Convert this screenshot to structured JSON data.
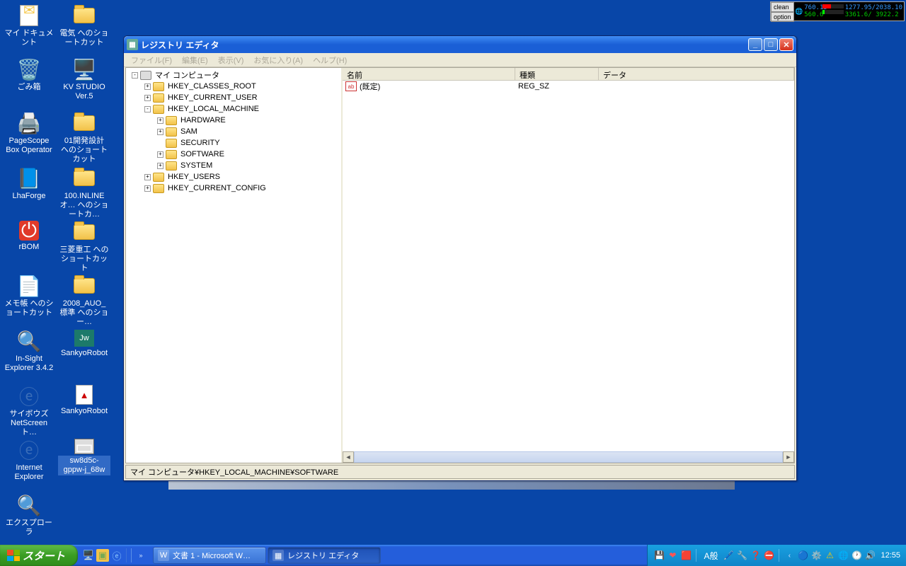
{
  "desktop_icons": {
    "col1": [
      {
        "label": "マイ ドキュメント",
        "glyph": "doc"
      },
      {
        "label": "ごみ箱",
        "glyph": "trash"
      },
      {
        "label": "PageScope Box Operator",
        "glyph": "app"
      },
      {
        "label": "LhaForge",
        "glyph": "app"
      },
      {
        "label": "rBOM",
        "glyph": "rbom"
      },
      {
        "label": "メモ帳 へのショートカット",
        "glyph": "word"
      },
      {
        "label": "In-Sight Explorer 3.4.2",
        "glyph": "app"
      },
      {
        "label": "サイボウズ NetScreen ト…",
        "glyph": "ie"
      },
      {
        "label": "Internet Explorer",
        "glyph": "ie"
      },
      {
        "label": "エクスプローラ",
        "glyph": "app"
      }
    ],
    "col2": [
      {
        "label": "電気 へのショートカット",
        "glyph": "folder"
      },
      {
        "label": "KV STUDIO Ver.5",
        "glyph": "app"
      },
      {
        "label": "01開発設計 へのショートカット",
        "glyph": "folder"
      },
      {
        "label": "100.INLINEオ… へのショートカ…",
        "glyph": "folder"
      },
      {
        "label": "三菱重工 へのショートカット",
        "glyph": "folder"
      },
      {
        "label": "2008_AUO_標準 へのショー…",
        "glyph": "folder"
      },
      {
        "label": "SankyoRobot",
        "glyph": "app"
      },
      {
        "label": "SankyoRobot",
        "glyph": "pdf"
      },
      {
        "label": "sw8d5c-gppw-j_68w",
        "glyph": "app",
        "selected": true
      }
    ]
  },
  "sysmon": {
    "btn1": "clean",
    "btn2": "option",
    "line1": "760.15",
    "line1b": "1277.95/2038.10",
    "line2": "560.6",
    "line2b": "3361.6/ 3922.2"
  },
  "regedit": {
    "title": "レジストリ エディタ",
    "menu": [
      "ファイル(F)",
      "編集(E)",
      "表示(V)",
      "お気に入り(A)",
      "ヘルプ(H)"
    ],
    "tree": [
      {
        "level": 0,
        "expand": "-",
        "icon": "pc",
        "label": "マイ コンピュータ"
      },
      {
        "level": 1,
        "expand": "+",
        "icon": "f",
        "label": "HKEY_CLASSES_ROOT"
      },
      {
        "level": 1,
        "expand": "+",
        "icon": "f",
        "label": "HKEY_CURRENT_USER"
      },
      {
        "level": 1,
        "expand": "-",
        "icon": "f",
        "label": "HKEY_LOCAL_MACHINE"
      },
      {
        "level": 2,
        "expand": "+",
        "icon": "f",
        "label": "HARDWARE"
      },
      {
        "level": 2,
        "expand": "+",
        "icon": "f",
        "label": "SAM"
      },
      {
        "level": 2,
        "expand": " ",
        "icon": "f",
        "label": "SECURITY"
      },
      {
        "level": 2,
        "expand": "+",
        "icon": "f",
        "label": "SOFTWARE"
      },
      {
        "level": 2,
        "expand": "+",
        "icon": "f",
        "label": "SYSTEM"
      },
      {
        "level": 1,
        "expand": "+",
        "icon": "f",
        "label": "HKEY_USERS"
      },
      {
        "level": 1,
        "expand": "+",
        "icon": "f",
        "label": "HKEY_CURRENT_CONFIG"
      }
    ],
    "columns": {
      "c1": "名前",
      "c2": "種類",
      "c3": "データ"
    },
    "rows": [
      {
        "name": "(既定)",
        "type": "REG_SZ",
        "data": ""
      }
    ],
    "status": "マイ コンピュータ¥HKEY_LOCAL_MACHINE¥SOFTWARE"
  },
  "taskbar": {
    "start": "スタート",
    "tasks": [
      {
        "label": "文書 1 - Microsoft W…",
        "icon": "W"
      },
      {
        "label": "レジストリ エディタ",
        "icon": "▦",
        "active": true
      }
    ],
    "lang": "A般",
    "clock": "12:55"
  }
}
